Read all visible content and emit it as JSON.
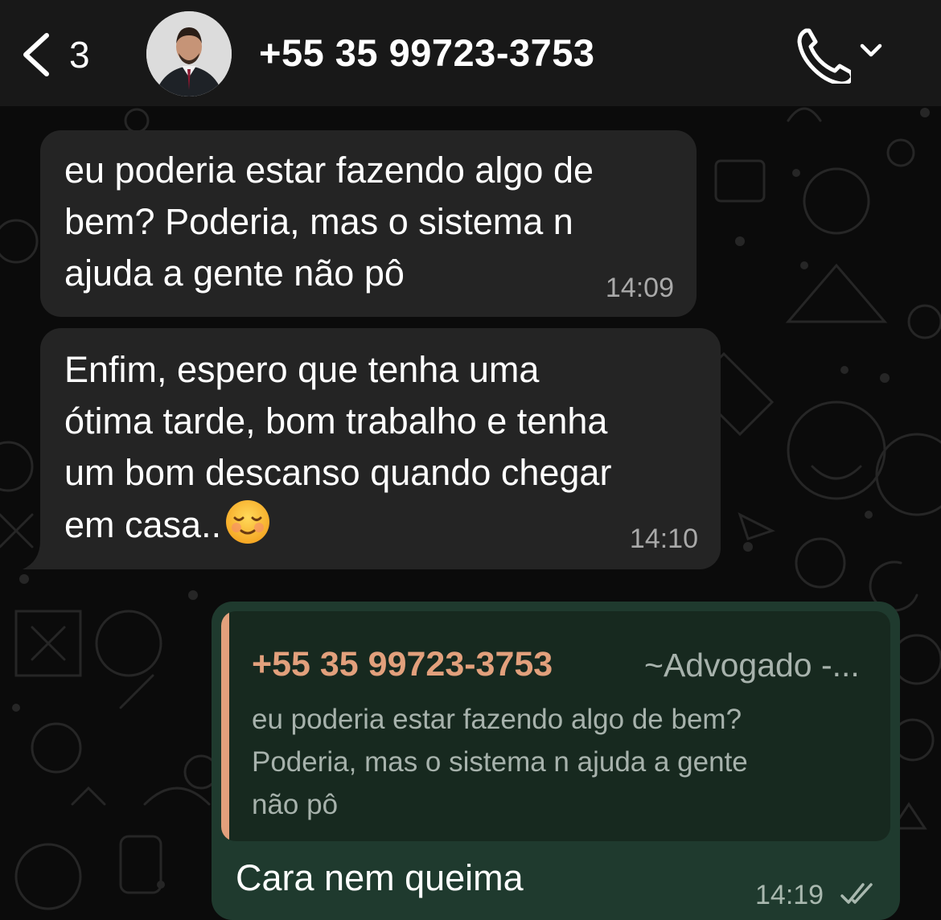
{
  "header": {
    "back_label": "3",
    "contact_name": "+55 35 99723-3753"
  },
  "messages": [
    {
      "direction": "incoming",
      "text": "eu poderia estar fazendo algo de\nbem? Poderia, mas o sistema n\najuda a gente não pô",
      "time": "14:09"
    },
    {
      "direction": "incoming",
      "text": "Enfim, espero que tenha uma\nótima tarde, bom trabalho e tenha\num bom descanso quando chegar\nem casa..",
      "emoji": "smiling-face-icon",
      "time": "14:10"
    },
    {
      "direction": "outgoing",
      "quoted": {
        "sender": "+55 35 99723-3753",
        "push_name": "~Advogado -...",
        "text": "eu poderia estar fazendo algo de bem?\nPoderia, mas o sistema n ajuda a gente\nnão pô"
      },
      "text": "Cara nem queima",
      "time": "14:19",
      "status": "delivered"
    }
  ],
  "colors": {
    "incoming_bubble": "#242424",
    "outgoing_bubble": "#1f3a2e",
    "quote_accent": "#e2a07c",
    "header": "#181818"
  }
}
